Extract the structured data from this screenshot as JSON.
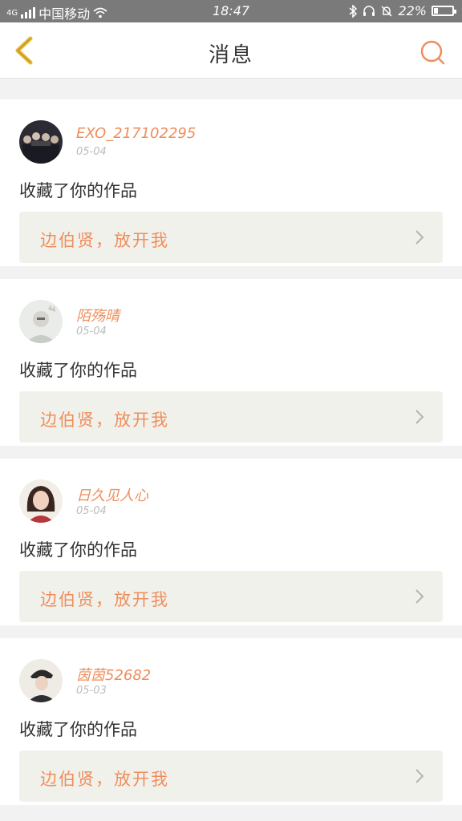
{
  "status_bar": {
    "network": "4G",
    "carrier": "中国移动",
    "time": "18:47",
    "battery_text": "22%",
    "battery_level": 0.22,
    "icons": [
      "signal-icon",
      "wifi-icon",
      "bluetooth-icon",
      "headset-icon",
      "mute-icon",
      "battery-icon"
    ]
  },
  "nav": {
    "title": "消息",
    "back_icon": "back-chevron-icon",
    "search_icon": "search-icon"
  },
  "colors": {
    "accent": "#ef8e5c",
    "back_icon": "#e8b830",
    "card_box": "#f1f1ec"
  },
  "messages": [
    {
      "username": "EXO_217102295",
      "date": "05-04",
      "action": "收藏了你的作品",
      "work_title": "边伯贤，放开我"
    },
    {
      "username": "陌殇晴",
      "date": "05-04",
      "action": "收藏了你的作品",
      "work_title": "边伯贤，放开我"
    },
    {
      "username": "日久见人心",
      "date": "05-04",
      "action": "收藏了你的作品",
      "work_title": "边伯贤，放开我"
    },
    {
      "username": "茵茵52682",
      "date": "05-03",
      "action": "收藏了你的作品",
      "work_title": "边伯贤，放开我"
    }
  ]
}
